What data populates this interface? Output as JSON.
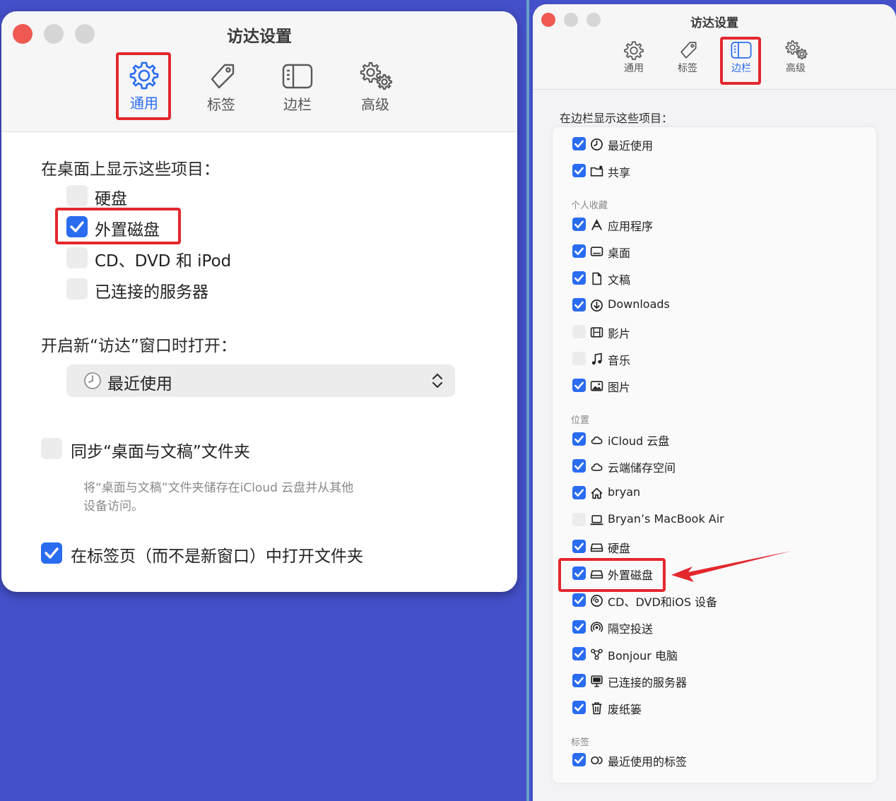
{
  "left_window": {
    "title": "访达设置",
    "tabs": [
      {
        "label": "通用",
        "selected": true
      },
      {
        "label": "标签",
        "selected": false
      },
      {
        "label": "边栏",
        "selected": false
      },
      {
        "label": "高级",
        "selected": false
      }
    ],
    "desktop_section": {
      "heading": "在桌面上显示这些项目：",
      "items": [
        {
          "label": "硬盘",
          "checked": false
        },
        {
          "label": "外置磁盘",
          "checked": true
        },
        {
          "label": "CD、DVD 和 iPod",
          "checked": false
        },
        {
          "label": "已连接的服务器",
          "checked": false
        }
      ]
    },
    "new_window_section": {
      "heading": "开启新“访达”窗口时打开：",
      "selected_value": "最近使用"
    },
    "sync_option": {
      "label": "同步“桌面与文稿”文件夹",
      "checked": false,
      "description_line1": "将“桌面与文稿”文件夹储存在iCloud 云盘并从其他",
      "description_line2": "设备访问。"
    },
    "tabs_option": {
      "label": "在标签页（而不是新窗口）中打开文件夹",
      "checked": true
    }
  },
  "right_window": {
    "title": "访达设置",
    "tabs": [
      {
        "label": "通用",
        "selected": false
      },
      {
        "label": "标签",
        "selected": false
      },
      {
        "label": "边栏",
        "selected": true
      },
      {
        "label": "高级",
        "selected": false
      }
    ],
    "heading": "在边栏显示这些项目：",
    "top_items": [
      {
        "label": "最近使用",
        "checked": true,
        "icon": "clock-icon"
      },
      {
        "label": "共享",
        "checked": true,
        "icon": "shared-folder-icon"
      }
    ],
    "favorites": {
      "label": "个人收藏",
      "items": [
        {
          "label": "应用程序",
          "checked": true,
          "icon": "applications-icon"
        },
        {
          "label": "桌面",
          "checked": true,
          "icon": "desktop-icon"
        },
        {
          "label": "文稿",
          "checked": true,
          "icon": "document-icon"
        },
        {
          "label": "Downloads",
          "checked": true,
          "icon": "download-icon"
        },
        {
          "label": "影片",
          "checked": false,
          "icon": "film-icon"
        },
        {
          "label": "音乐",
          "checked": false,
          "icon": "music-icon"
        },
        {
          "label": "图片",
          "checked": true,
          "icon": "photo-icon"
        }
      ]
    },
    "locations": {
      "label": "位置",
      "items": [
        {
          "label": "iCloud 云盘",
          "checked": true,
          "icon": "cloud-icon"
        },
        {
          "label": "云端储存空间",
          "checked": true,
          "icon": "cloud-storage-icon"
        },
        {
          "label": "bryan",
          "checked": true,
          "icon": "home-icon"
        },
        {
          "label": "Bryan’s MacBook Air",
          "checked": false,
          "icon": "laptop-icon"
        },
        {
          "label": "硬盘",
          "checked": true,
          "icon": "hard-disk-icon"
        },
        {
          "label": "外置磁盘",
          "checked": true,
          "icon": "external-disk-icon"
        },
        {
          "label": "CD、DVD和iOS 设备",
          "checked": true,
          "icon": "disc-icon"
        },
        {
          "label": "隔空投送",
          "checked": true,
          "icon": "airdrop-icon"
        },
        {
          "label": "Bonjour 电脑",
          "checked": true,
          "icon": "bonjour-icon"
        },
        {
          "label": "已连接的服务器",
          "checked": true,
          "icon": "server-icon"
        },
        {
          "label": "废纸篓",
          "checked": true,
          "icon": "trash-icon"
        }
      ]
    },
    "tags": {
      "label": "标签",
      "items": [
        {
          "label": "最近使用的标签",
          "checked": true,
          "icon": "tags-icon"
        }
      ]
    }
  },
  "colors": {
    "accent_blue": "#2a6cf0",
    "highlight_red": "#e3282e",
    "background": "#4350c9",
    "close": "#ee5a52",
    "inactive_light": "#d6d6d6"
  }
}
